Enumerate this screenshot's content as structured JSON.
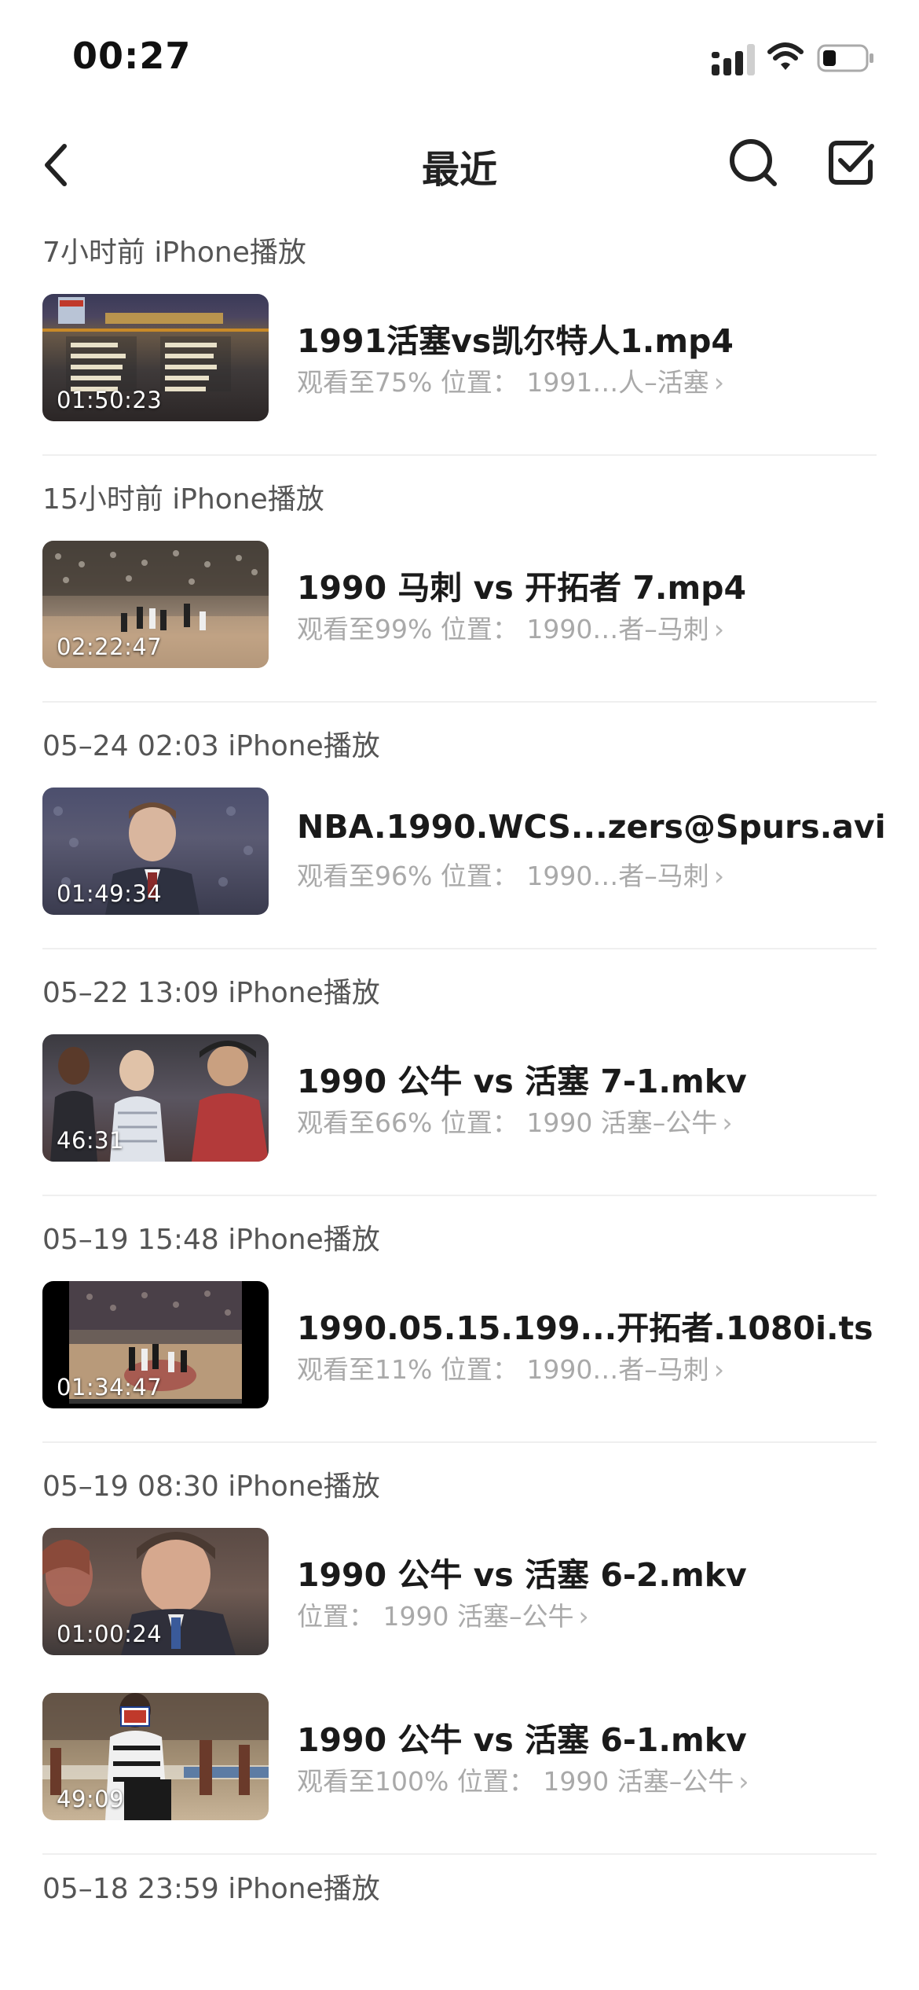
{
  "status_bar": {
    "time": "00:27"
  },
  "nav": {
    "title": "最近"
  },
  "colors": {
    "title_text": "#1a1a1a",
    "secondary_text": "#a9a9a9",
    "section_text": "#555555",
    "divider": "#efefef"
  },
  "icons": {
    "back": "chevron-left-icon",
    "search": "search-icon",
    "select": "checkbox-icon",
    "signal": "signal-icon",
    "wifi": "wifi-icon",
    "battery": "battery-icon"
  },
  "sections": [
    {
      "header": "7小时前 iPhone播放",
      "items": [
        {
          "title": "1991活塞vs凯尔特人1.mp4",
          "progress": "观看至75% 位置：  1991…人–活塞",
          "duration": "01:50:23"
        }
      ]
    },
    {
      "header": "15小时前 iPhone播放",
      "items": [
        {
          "title": "1990 马刺 vs 开拓者 7.mp4",
          "progress": "观看至99% 位置：  1990…者–马刺",
          "duration": "02:22:47"
        }
      ]
    },
    {
      "header": "05–24 02:03 iPhone播放",
      "items": [
        {
          "title": "NBA.1990.WCS...zers@Spurs.avi",
          "progress": "观看至96% 位置：  1990…者–马刺",
          "duration": "01:49:34"
        }
      ]
    },
    {
      "header": "05–22 13:09 iPhone播放",
      "items": [
        {
          "title": "1990 公牛 vs 活塞 7-1.mkv",
          "progress": "观看至66% 位置：  1990 活塞–公牛",
          "duration": "46:31"
        }
      ]
    },
    {
      "header": "05–19 15:48 iPhone播放",
      "items": [
        {
          "title": "1990.05.15.199...开拓者.1080i.ts",
          "progress": "观看至11% 位置：  1990…者–马刺",
          "duration": "01:34:47"
        }
      ]
    },
    {
      "header": "05–19 08:30 iPhone播放",
      "items": [
        {
          "title": "1990 公牛 vs 活塞 6-2.mkv",
          "progress": "位置：  1990 活塞–公牛",
          "duration": "01:00:24"
        },
        {
          "title": "1990 公牛 vs 活塞 6-1.mkv",
          "progress": "观看至100% 位置：  1990 活塞–公牛",
          "duration": "49:09"
        }
      ]
    }
  ],
  "partial_section": {
    "header": "05–18 23:59 iPhone播放"
  }
}
